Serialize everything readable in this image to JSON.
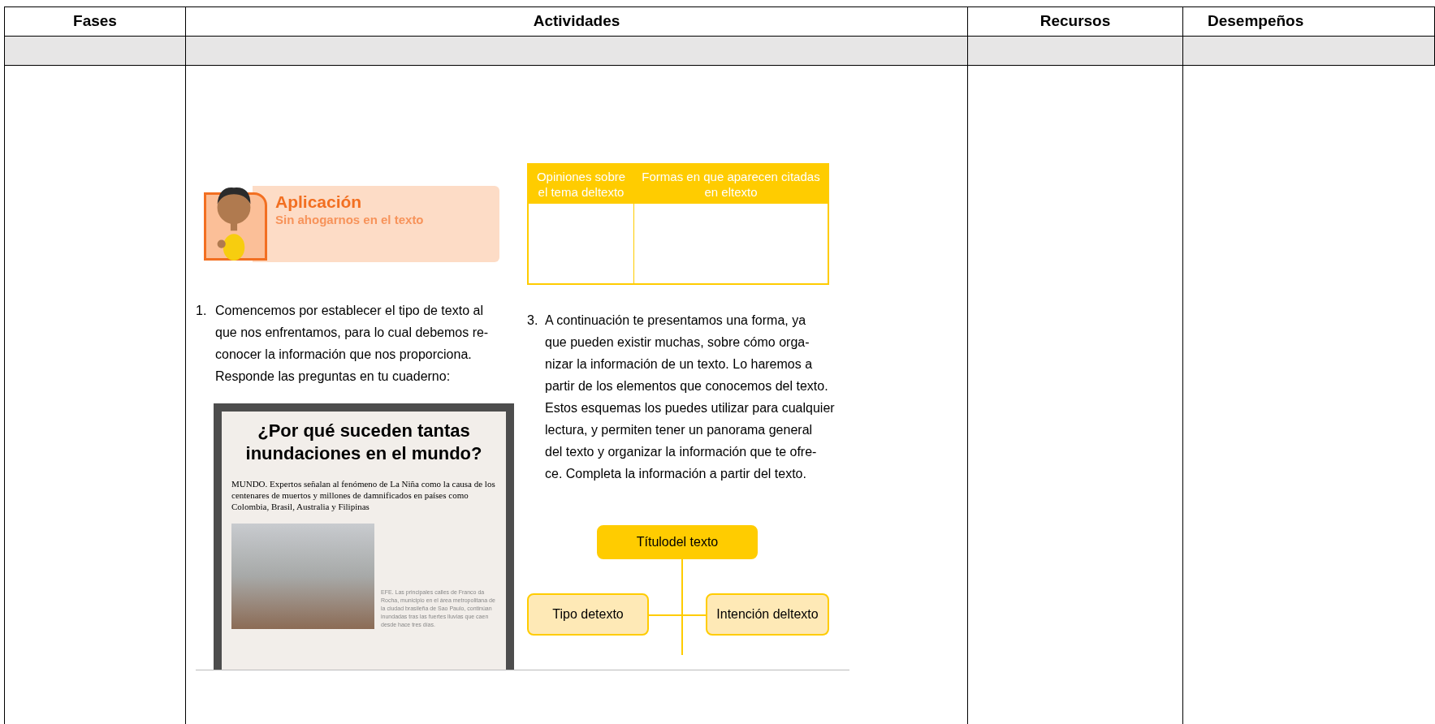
{
  "table": {
    "columns": [
      "Fases",
      "Actividades",
      "Recursos",
      "Desempeños"
    ]
  },
  "worksheet": {
    "banner": {
      "title": "Aplicación",
      "subtitle": "Sin ahogarnos en el texto"
    },
    "opinion_table": {
      "columns": [
        "Opiniones sobre el tema deltexto",
        "Formas en que aparecen citadas en eltexto"
      ]
    },
    "step_1": {
      "number": "1.",
      "lines": [
        "Comencemos por establecer el tipo de texto al",
        "que nos enfrentamos, para lo cual debemos re-",
        "conocer la información que nos proporciona.",
        "Responde las preguntas en tu cuaderno:"
      ]
    },
    "news_clipping": {
      "headline": "¿Por qué suceden tantas inundaciones en el mundo?",
      "lead": "MUNDO. Expertos señalan al fenómeno de La Niña como la causa de los centenares de muertos y millones de damnificados en países como Colombia, Brasil, Australia y Filipinas",
      "caption": "EFE. Las principales calles de Franco da Rocha, municipio en el área metropolitana de la ciudad brasileña de Sao Paulo, continúan inundadas tras las fuertes lluvias que caen desde hace tres días."
    },
    "step_3": {
      "number": "3.",
      "lines": [
        "A continuación te presentamos una forma, ya",
        "que pueden existir muchas, sobre cómo orga-",
        "nizar la información de un texto. Lo haremos a",
        "partir de los elementos que conocemos del texto.",
        "Estos esquemas los puedes utilizar para cualquier",
        "lectura, y permiten tener un panorama general",
        "del texto y organizar la información que te ofre-",
        "ce. Completa la información a partir del texto."
      ]
    },
    "diagram": {
      "nodes": [
        {
          "kind": "title",
          "label": "Títulodel texto"
        },
        {
          "kind": "branch",
          "label": "Tipo detexto"
        },
        {
          "kind": "branch",
          "label": "Intención deltexto"
        }
      ]
    }
  }
}
